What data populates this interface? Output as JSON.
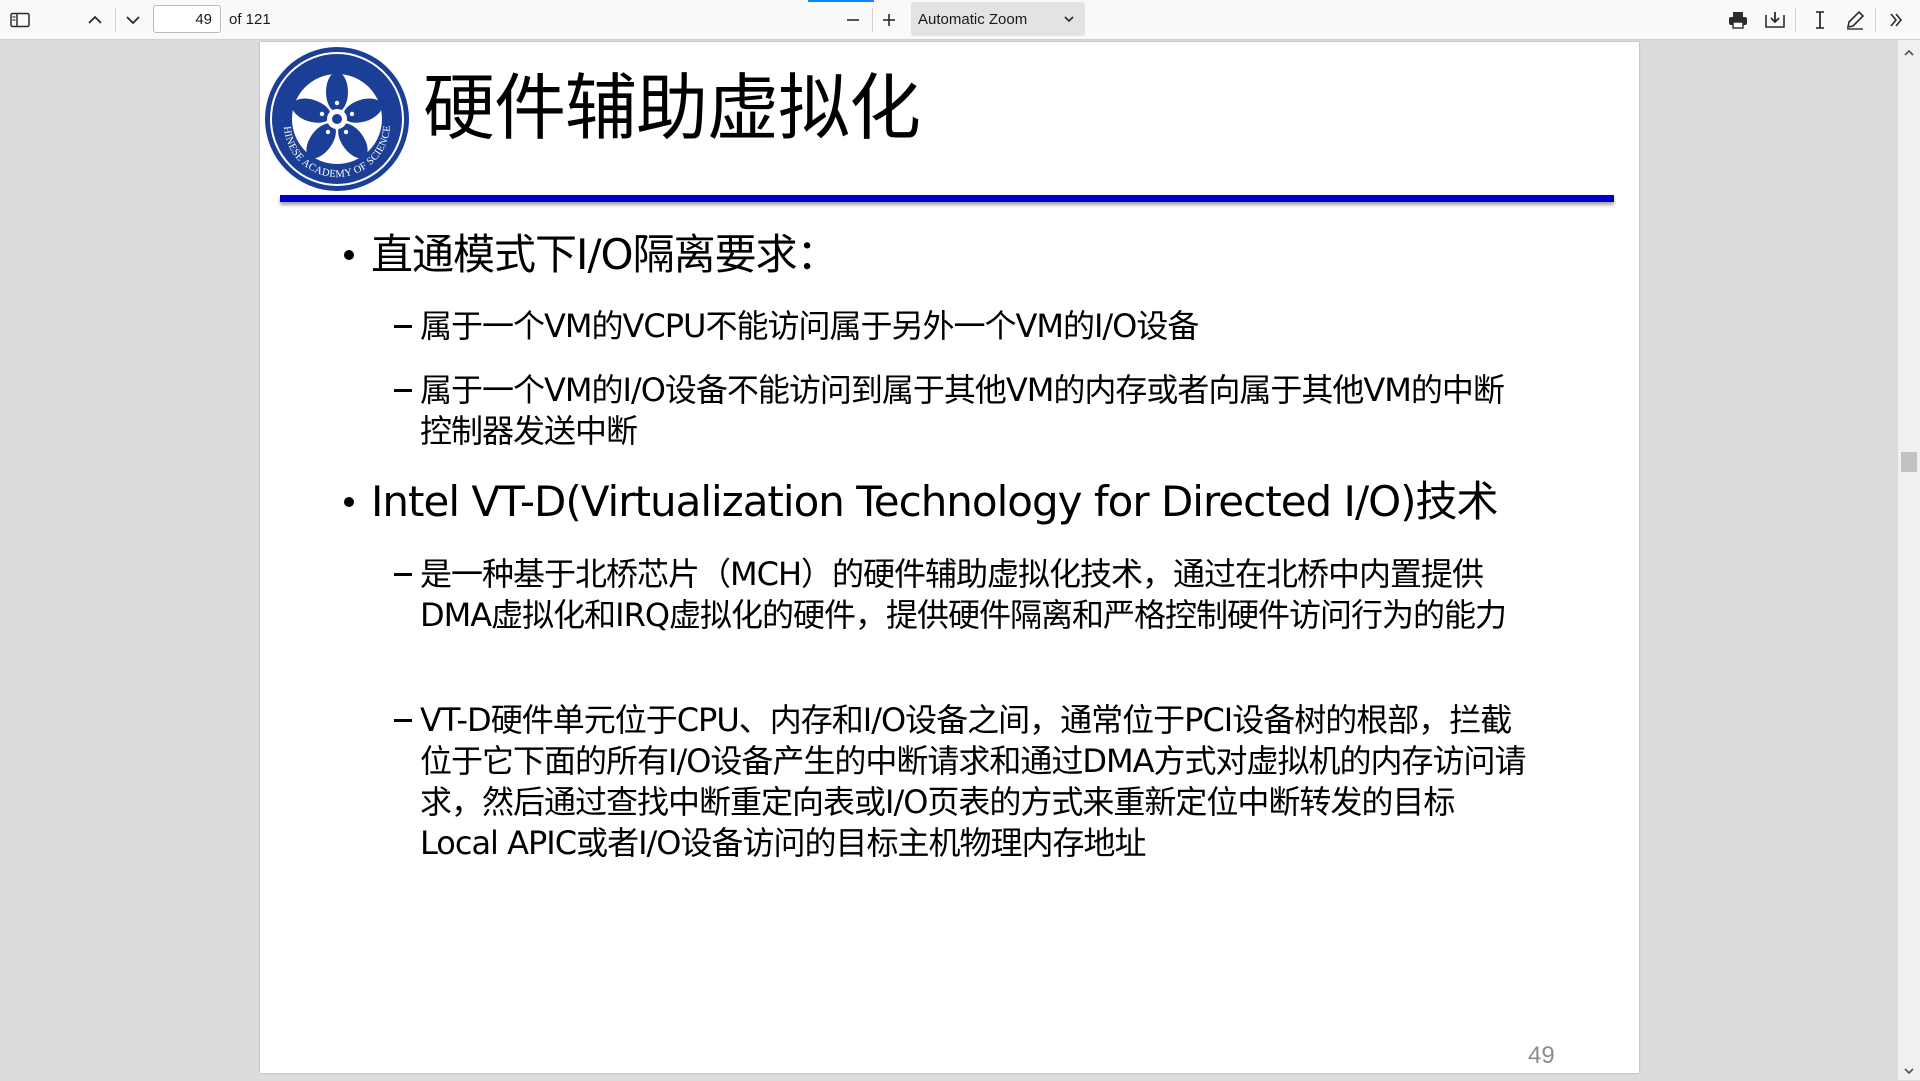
{
  "toolbar": {
    "page_number": "49",
    "page_count_label": "of 121",
    "zoom_label": "Automatic Zoom",
    "accent_color": "#0a84ff",
    "icons": [
      "sidebar-toggle-icon",
      "chevron-up-icon",
      "chevron-down-icon",
      "zoom-out-icon",
      "zoom-in-icon",
      "print-icon",
      "download-icon",
      "text-cursor-icon",
      "pen-icon",
      "double-chevron-right-icon"
    ]
  },
  "slide": {
    "logo_text": "CHINESE ACADEMY OF SCIENCES",
    "title": "硬件辅助虚拟化",
    "rule_color": "#0000cc",
    "bullets": [
      {
        "text": "直通模式下I/O隔离要求：",
        "subs": [
          "属于一个VM的VCPU不能访问属于另外一个VM的I/O设备",
          "属于一个VM的I/O设备不能访问到属于其他VM的内存或者向属于其他VM的中断控制器发送中断"
        ]
      },
      {
        "text": "Intel VT-D(Virtualization Technology for Directed I/O)技术",
        "subs": [
          "是一种基于北桥芯片（MCH）的硬件辅助虚拟化技术，通过在北桥中内置提供DMA虚拟化和IRQ虚拟化的硬件，提供硬件隔离和严格控制硬件访问行为的能力",
          "VT-D硬件单元位于CPU、内存和I/O设备之间，通常位于PCI设备树的根部，拦截位于它下面的所有I/O设备产生的中断请求和通过DMA方式对虚拟机的内存访问请求，然后通过查找中断重定向表或I/O页表的方式来重新定位中断转发的目标Local APIC或者I/O设备访问的目标主机物理内存地址"
        ]
      }
    ],
    "page_number": "49"
  }
}
